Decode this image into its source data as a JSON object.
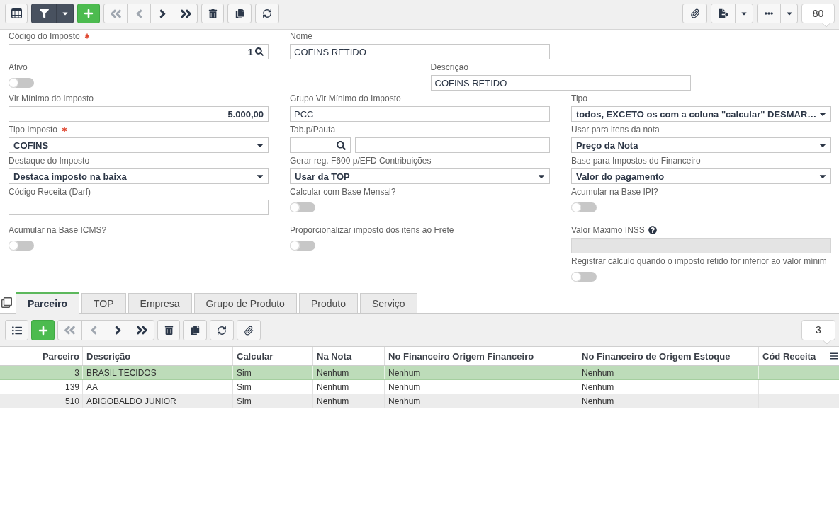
{
  "toolbar": {
    "navigation": [
      {
        "disabled": true
      },
      {
        "disabled": true
      },
      {
        "disabled": false
      },
      {
        "disabled": false
      }
    ],
    "counter": "80"
  },
  "form": {
    "fields": [
      {
        "kind": "lookup",
        "label": "Código do Imposto",
        "value": "1",
        "required": true,
        "disabled": false,
        "help": false
      },
      {
        "kind": "text",
        "label": "Nome",
        "value": "COFINS RETIDO",
        "required": false,
        "disabled": false,
        "help": false
      },
      {
        "kind": "toggle",
        "label": "Ativo",
        "on": false,
        "required": false,
        "disabled": false,
        "help": false
      },
      {
        "kind": "text",
        "label": "Descrição",
        "value": "COFINS RETIDO",
        "required": false,
        "disabled": false,
        "help": false
      },
      {
        "kind": "number",
        "label": "Vlr Mínimo do Imposto",
        "value": "5.000,00",
        "required": false,
        "disabled": false,
        "help": false
      },
      {
        "kind": "text",
        "label": "Grupo Vlr Mínimo do Imposto",
        "value": "PCC",
        "required": false,
        "disabled": false,
        "help": false
      },
      {
        "kind": "select",
        "label": "Tipo",
        "value": "todos, EXCETO os com a coluna \"calcular\" DESMAR…",
        "required": false,
        "disabled": false,
        "help": false
      },
      {
        "kind": "select",
        "label": "Tipo Imposto",
        "value": "COFINS",
        "required": true,
        "disabled": false,
        "help": false
      },
      {
        "kind": "lookup-pair",
        "label": "Tab.p/Pauta",
        "required": false,
        "disabled": false,
        "help": false
      },
      {
        "kind": "select",
        "label": "Usar para itens da nota",
        "value": "Preço da Nota",
        "required": false,
        "disabled": false,
        "help": false
      },
      {
        "kind": "select",
        "label": "Destaque do Imposto",
        "value": "Destaca imposto na baixa",
        "required": false,
        "disabled": false,
        "help": false
      },
      {
        "kind": "select",
        "label": "Gerar reg. F600 p/EFD Contribuições",
        "value": "Usar da TOP",
        "required": false,
        "disabled": false,
        "help": false
      },
      {
        "kind": "select",
        "label": "Base para Impostos do Financeiro",
        "value": "Valor do pagamento",
        "required": false,
        "disabled": false,
        "help": false
      },
      {
        "kind": "text",
        "label": "Código Receita (Darf)",
        "required": false,
        "disabled": false,
        "help": false
      },
      {
        "kind": "toggle",
        "label": "Calcular com Base Mensal?",
        "on": false,
        "required": false,
        "disabled": false,
        "help": false
      },
      {
        "kind": "toggle",
        "label": "Acumular na Base IPI?",
        "on": false,
        "required": false,
        "disabled": false,
        "help": false
      },
      {
        "kind": "toggle",
        "label": "Acumular na Base ICMS?",
        "on": false,
        "required": false,
        "disabled": false,
        "help": false
      },
      {
        "kind": "toggle",
        "label": "Proporcionalizar imposto dos itens ao Frete",
        "on": false,
        "required": false,
        "disabled": false,
        "help": false
      },
      {
        "kind": "text",
        "label": "Valor Máximo INSS",
        "required": false,
        "disabled": true,
        "help": true
      },
      {
        "kind": "toggle",
        "label": "Registrar cálculo quando o imposto retido for inferior ao valor mínim",
        "on": false,
        "required": false,
        "disabled": false,
        "help": false
      }
    ]
  },
  "detail_tabs": [
    {
      "label": "Parceiro",
      "selected": true
    },
    {
      "label": "TOP",
      "selected": false
    },
    {
      "label": "Empresa",
      "selected": false
    },
    {
      "label": "Grupo de Produto",
      "selected": false
    },
    {
      "label": "Produto",
      "selected": false
    },
    {
      "label": "Serviço",
      "selected": false
    }
  ],
  "detail_toolbar": {
    "navigation": [
      {
        "disabled": true
      },
      {
        "disabled": true
      },
      {
        "disabled": false
      },
      {
        "disabled": false
      }
    ],
    "counter": "3"
  },
  "table": {
    "columns": [
      {
        "label": "Parceiro",
        "kind": "number"
      },
      {
        "label": "Descrição",
        "kind": "text"
      },
      {
        "label": "Calcular",
        "kind": "text"
      },
      {
        "label": "Na Nota",
        "kind": "text"
      },
      {
        "label": "No Financeiro Origem Financeiro",
        "kind": "text"
      },
      {
        "label": "No Financeiro de Origem Estoque",
        "kind": "text"
      },
      {
        "label": "Cód Receita",
        "kind": "text"
      }
    ],
    "rows": [
      {
        "selected": true,
        "cells": [
          "3",
          "BRASIL TECIDOS",
          "Sim",
          "Nenhum",
          "Nenhum",
          "Nenhum"
        ]
      },
      {
        "selected": false,
        "cells": [
          "139",
          "AA",
          "Sim",
          "Nenhum",
          "Nenhum",
          "Nenhum"
        ]
      },
      {
        "selected": false,
        "cells": [
          "510",
          "ABIGOBALDO JUNIOR",
          "Sim",
          "Nenhum",
          "Nenhum",
          "Nenhum"
        ]
      }
    ]
  }
}
